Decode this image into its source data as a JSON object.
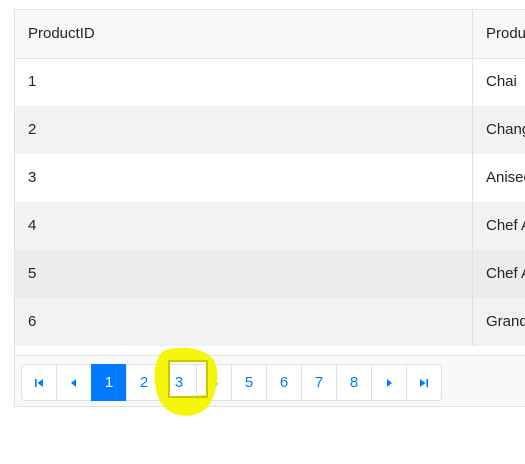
{
  "grid": {
    "columns": [
      "ProductID",
      "Produ"
    ],
    "rows": [
      {
        "id": "1",
        "name": "Chai"
      },
      {
        "id": "2",
        "name": "Chang"
      },
      {
        "id": "3",
        "name": "Anised"
      },
      {
        "id": "4",
        "name": "Chef A"
      },
      {
        "id": "5",
        "name": "Chef A"
      },
      {
        "id": "6",
        "name": "Grand"
      }
    ]
  },
  "pager": {
    "pages": [
      "1",
      "2",
      "3",
      "4",
      "5",
      "6",
      "7",
      "8"
    ],
    "current_page": "1",
    "icons": {
      "first": "first-page-icon",
      "prev": "previous-page-icon",
      "next": "next-page-icon",
      "last": "last-page-icon"
    }
  },
  "colors": {
    "accent": "#007bff",
    "highlight": "#f5f500",
    "row_alt": "#f2f2f2",
    "border": "#dee2e6"
  }
}
